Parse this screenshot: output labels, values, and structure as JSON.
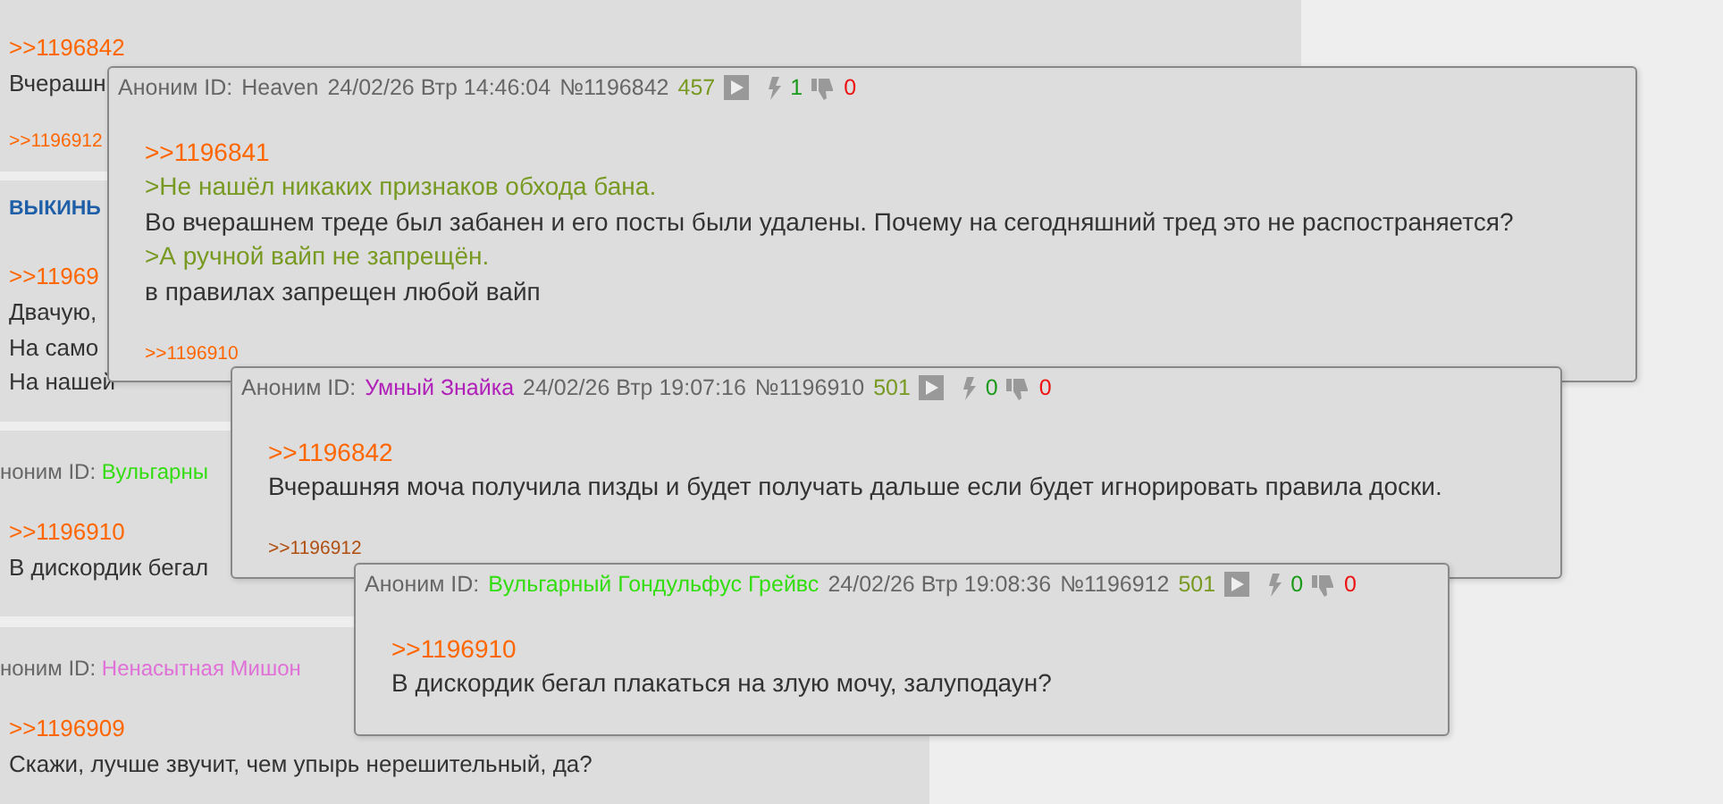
{
  "background_posts": [
    {
      "reply_link": ">>1196842",
      "lines": [
        {
          "kind": "text",
          "text": "Вчерашн"
        }
      ],
      "backlinks": [
        {
          "text": ">>1196912",
          "visited": false
        }
      ],
      "wide": true
    },
    {
      "title": "ВЫКИНЬ",
      "reply_link": ">>11969",
      "lines": [
        {
          "kind": "text",
          "text": "Двачую,"
        },
        {
          "kind": "text",
          "text": "На само"
        },
        {
          "kind": "text",
          "text": "На нашей"
        }
      ],
      "wide": true
    },
    {
      "header": {
        "prefix": "ноним ID:",
        "name": "Вульгарны",
        "color": "#33dd11"
      },
      "reply_link": ">>1196910",
      "lines": [
        {
          "kind": "text",
          "text": "В дискордик бегал"
        }
      ],
      "wide": false
    },
    {
      "header": {
        "prefix": "ноним ID:",
        "name": "Ненасытная Мишон",
        "color": "#e070d8"
      },
      "reply_link": ">>1196909",
      "lines": [
        {
          "kind": "text",
          "text": "Скажи, лучше звучит, чем упырь нерешительный, да?"
        }
      ],
      "wide": false
    }
  ],
  "popups": [
    {
      "prefix": "Аноним ID:",
      "name": "Heaven",
      "color": "#666666",
      "date": "24/02/26 Втр 14:46:04",
      "number": "№1196842",
      "count": "457",
      "likes": "1",
      "dislikes": "0",
      "reply_link": ">>1196841",
      "lines": [
        {
          "kind": "quote",
          "text": ">Не нашёл никаких признаков обхода бана."
        },
        {
          "kind": "text",
          "text": "Во вчерашнем треде был забанен и его посты были удалены. Почему на сегодняшний тред это не распостраняется?"
        },
        {
          "kind": "quote",
          "text": ">А ручной вайп не запрещён."
        },
        {
          "kind": "text",
          "text": "в правилах запрещен любой вайп"
        }
      ],
      "backlinks": [
        {
          "text": ">>1196910",
          "visited": false
        }
      ]
    },
    {
      "prefix": "Аноним ID:",
      "name": "Умный Знайка",
      "color": "#b020b8",
      "date": "24/02/26 Втр 19:07:16",
      "number": "№1196910",
      "count": "501",
      "likes": "0",
      "dislikes": "0",
      "reply_link": ">>1196842",
      "lines": [
        {
          "kind": "text",
          "text": "Вчерашняя моча получила пизды и будет получать дальше если будет игнорировать правила доски."
        }
      ],
      "backlinks": [
        {
          "text": ">>1196912",
          "visited": true
        }
      ]
    },
    {
      "prefix": "Аноним ID:",
      "name": "Вульгарный Гондульфус Грейвс",
      "color": "#33dd11",
      "date": "24/02/26 Втр 19:08:36",
      "number": "№1196912",
      "count": "501",
      "likes": "0",
      "dislikes": "0",
      "reply_link": ">>1196910",
      "lines": [
        {
          "kind": "text",
          "text": "В дискордик бегал плакаться на злую мочу, залуподаун?"
        }
      ]
    }
  ]
}
